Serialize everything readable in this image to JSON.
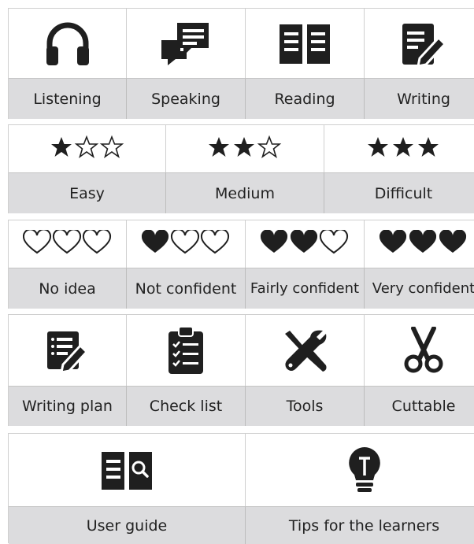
{
  "skills": [
    {
      "icon": "headphones-icon",
      "label": "Listening"
    },
    {
      "icon": "speech-bubbles-icon",
      "label": "Speaking"
    },
    {
      "icon": "open-book-icon",
      "label": "Reading"
    },
    {
      "icon": "writing-pen-icon",
      "label": "Writing"
    }
  ],
  "difficulty": [
    {
      "stars_filled": 1,
      "stars_total": 3,
      "label": "Easy"
    },
    {
      "stars_filled": 2,
      "stars_total": 3,
      "label": "Medium"
    },
    {
      "stars_filled": 3,
      "stars_total": 3,
      "label": "Difficult"
    }
  ],
  "confidence": [
    {
      "hearts_filled": 0,
      "hearts_total": 3,
      "label": "No idea"
    },
    {
      "hearts_filled": 1,
      "hearts_total": 3,
      "label": "Not confident"
    },
    {
      "hearts_filled": 2,
      "hearts_total": 3,
      "label": "Fairly confident"
    },
    {
      "hearts_filled": 3,
      "hearts_total": 3,
      "label": "Very confident"
    }
  ],
  "resources": [
    {
      "icon": "writing-plan-icon",
      "label": "Writing plan"
    },
    {
      "icon": "clipboard-checklist-icon",
      "label": "Check list"
    },
    {
      "icon": "tools-icon",
      "label": "Tools"
    },
    {
      "icon": "scissors-icon",
      "label": "Cuttable"
    }
  ],
  "guides": [
    {
      "icon": "book-search-icon",
      "label": "User guide"
    },
    {
      "icon": "lightbulb-icon",
      "label": "Tips for the learners"
    }
  ],
  "colors": {
    "icon": "#1f1f1f",
    "label_bg": "#dcdcde",
    "border": "#cfcfcf"
  }
}
